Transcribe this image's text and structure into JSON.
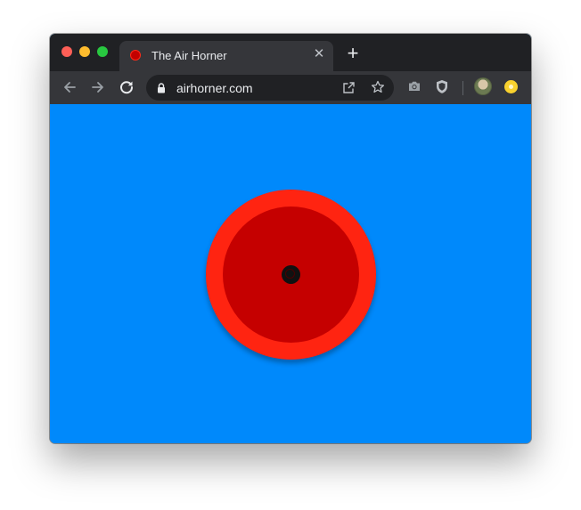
{
  "browser": {
    "tab": {
      "title": "The Air Horner",
      "favicon": "air-horner-icon"
    },
    "new_tab_symbol": "+",
    "close_symbol": "✕",
    "omnibox": {
      "url": "airhorner.com"
    },
    "icons": [
      "back-icon",
      "forward-icon",
      "reload-icon",
      "lock-icon",
      "open-in-new-icon",
      "star-icon",
      "camera-icon",
      "shield-icon",
      "avatar",
      "extension-icon"
    ]
  },
  "page": {
    "background_color": "#0089fb",
    "horn": {
      "outer_color": "#ff2411",
      "inner_color": "#c50000",
      "center_color": "#111111"
    }
  }
}
